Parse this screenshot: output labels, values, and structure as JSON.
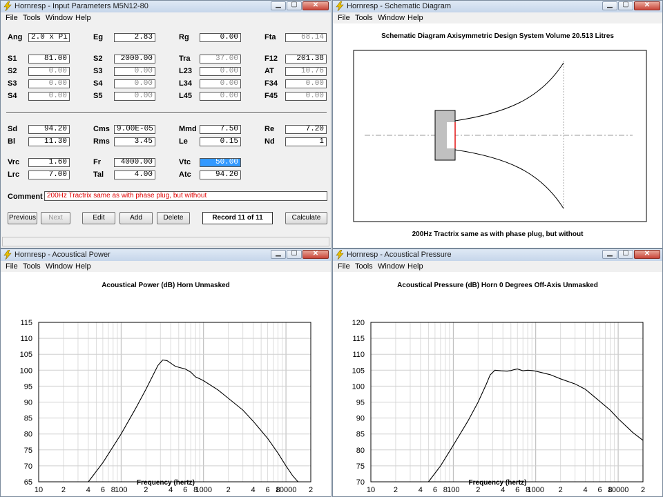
{
  "colors": {
    "titlebar": "#c6d6ea",
    "window_bg": "#f0f0f0",
    "plot_bg": "#ffffff",
    "comment_text": "#e00000",
    "selected_field": "#3399ff"
  },
  "icons": {
    "app": "lightning-icon",
    "minimize": "minimize-icon",
    "maximize": "maximize-icon",
    "close": "close-icon"
  },
  "menu": [
    "File",
    "Tools",
    "Window",
    "Help"
  ],
  "input": {
    "title": "Hornresp - Input Parameters   M5N12-80",
    "rows1": [
      [
        {
          "l": "Ang",
          "v": "2.0 x Pi",
          "s": "left"
        },
        {
          "l": "Eg",
          "v": "2.83"
        },
        {
          "l": "Rg",
          "v": "0.00"
        },
        {
          "l": "Fta",
          "v": "68.14",
          "s": "dis"
        }
      ],
      [
        {
          "l": "S1",
          "v": "81.00"
        },
        {
          "l": "S2",
          "v": "2000.00"
        },
        {
          "l": "Tra",
          "v": "37.00",
          "s": "dis"
        },
        {
          "l": "F12",
          "v": "201.38"
        }
      ],
      [
        {
          "l": "S2",
          "v": "0.00",
          "s": "dis"
        },
        {
          "l": "S3",
          "v": "0.00",
          "s": "dis"
        },
        {
          "l": "L23",
          "v": "0.00",
          "s": "dis"
        },
        {
          "l": "AT",
          "v": "10.76",
          "s": "dis"
        }
      ],
      [
        {
          "l": "S3",
          "v": "0.00",
          "s": "dis"
        },
        {
          "l": "S4",
          "v": "0.00",
          "s": "dis"
        },
        {
          "l": "L34",
          "v": "0.00",
          "s": "dis"
        },
        {
          "l": "F34",
          "v": "0.00",
          "s": "dis"
        }
      ],
      [
        {
          "l": "S4",
          "v": "0.00",
          "s": "dis"
        },
        {
          "l": "S5",
          "v": "0.00",
          "s": "dis"
        },
        {
          "l": "L45",
          "v": "0.00",
          "s": "dis"
        },
        {
          "l": "F45",
          "v": "0.00",
          "s": "dis"
        }
      ]
    ],
    "rows2": [
      [
        {
          "l": "Sd",
          "v": "94.20"
        },
        {
          "l": "Cms",
          "v": "9.00E-05",
          "s": "left"
        },
        {
          "l": "Mmd",
          "v": "7.50"
        },
        {
          "l": "Re",
          "v": "7.20"
        }
      ],
      [
        {
          "l": "Bl",
          "v": "11.30"
        },
        {
          "l": "Rms",
          "v": "3.45"
        },
        {
          "l": "Le",
          "v": "0.15"
        },
        {
          "l": "Nd",
          "v": "1"
        }
      ]
    ],
    "rows3": [
      [
        {
          "l": "Vrc",
          "v": "1.60"
        },
        {
          "l": "Fr",
          "v": "4000.00"
        },
        {
          "l": "Vtc",
          "v": "50.00",
          "s": "sel"
        },
        {
          "l": "",
          "v": "",
          "s": "none"
        }
      ],
      [
        {
          "l": "Lrc",
          "v": "7.00"
        },
        {
          "l": "Tal",
          "v": "4.00"
        },
        {
          "l": "Atc",
          "v": "94.20"
        },
        {
          "l": "",
          "v": "",
          "s": "none"
        }
      ]
    ],
    "comment_label": "Comment",
    "comment": "200Hz Tractrix  same as with phase plug, but without",
    "buttons": {
      "previous": "Previous",
      "next": "Next",
      "edit": "Edit",
      "add": "Add",
      "delete": "Delete",
      "calculate": "Calculate"
    },
    "record": "Record 11 of 11"
  },
  "schematic": {
    "title": "Hornresp - Schematic Diagram",
    "heading": "Schematic Diagram   Axisymmetric Design   System Volume 20.513 Litres",
    "caption": "200Hz Tractrix  same as with phase plug, but without"
  },
  "power": {
    "title": "Hornresp - Acoustical Power",
    "heading": "Acoustical Power (dB)   Horn    Unmasked",
    "xlabel": "Frequency (hertz)",
    "chart_data": {
      "type": "line",
      "title": "Acoustical Power (dB)   Horn    Unmasked",
      "xlabel": "Frequency (hertz)",
      "ylabel": "",
      "xscale": "log",
      "xlim": [
        10,
        20000
      ],
      "ylim": [
        65,
        115
      ],
      "yticks": [
        65,
        70,
        75,
        80,
        85,
        90,
        95,
        100,
        105,
        110,
        115
      ],
      "xtick_labels": [
        "10",
        "2",
        "4",
        "6",
        "8",
        "100",
        "2",
        "4",
        "6",
        "8",
        "1000",
        "2",
        "4",
        "6",
        "8",
        "10000",
        "2"
      ],
      "grid": true,
      "x": [
        40,
        60,
        100,
        150,
        200,
        250,
        280,
        320,
        360,
        400,
        450,
        500,
        600,
        700,
        800,
        900,
        1000,
        1500,
        2000,
        3000,
        4000,
        6000,
        8000,
        10000,
        12000,
        14000
      ],
      "y": [
        65,
        71,
        80,
        88,
        94,
        99,
        101.5,
        103.2,
        103.0,
        102.2,
        101.3,
        100.9,
        100.4,
        99.4,
        97.9,
        97.3,
        96.7,
        93.8,
        91.2,
        87.5,
        84.0,
        78.6,
        74.0,
        70.0,
        67.0,
        65
      ]
    }
  },
  "pressure": {
    "title": "Hornresp - Acoustical Pressure",
    "heading": "Acoustical Pressure (dB)   Horn    0 Degrees Off-Axis    Unmasked",
    "xlabel": "Frequency (hertz)",
    "chart_data": {
      "type": "line",
      "title": "Acoustical Pressure (dB)   Horn    0 Degrees Off-Axis    Unmasked",
      "xlabel": "Frequency (hertz)",
      "ylabel": "",
      "xscale": "log",
      "xlim": [
        10,
        20000
      ],
      "ylim": [
        70,
        120
      ],
      "yticks": [
        70,
        75,
        80,
        85,
        90,
        95,
        100,
        105,
        110,
        115,
        120
      ],
      "xtick_labels": [
        "10",
        "2",
        "4",
        "6",
        "8",
        "100",
        "2",
        "4",
        "6",
        "8",
        "1000",
        "2",
        "4",
        "6",
        "8",
        "10000",
        "2"
      ],
      "grid": true,
      "x": [
        50,
        70,
        100,
        150,
        200,
        250,
        280,
        320,
        380,
        450,
        500,
        550,
        600,
        700,
        800,
        900,
        1000,
        1500,
        2000,
        3000,
        4000,
        6000,
        8000,
        10000,
        15000,
        20000
      ],
      "y": [
        70,
        75,
        81.5,
        89,
        95,
        100.5,
        103.5,
        105,
        104.8,
        104.7,
        104.9,
        105.2,
        105.4,
        104.8,
        105.0,
        104.9,
        104.7,
        103.6,
        102.3,
        100.7,
        99.0,
        95.2,
        92.5,
        89.8,
        85.5,
        83.0
      ]
    }
  }
}
